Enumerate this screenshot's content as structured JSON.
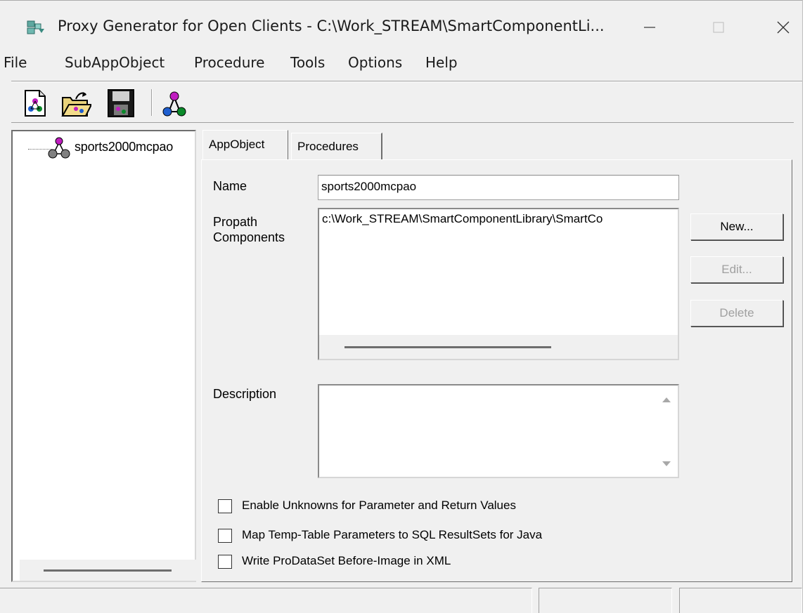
{
  "window": {
    "title": "Proxy Generator for Open Clients - C:\\Work_STREAM\\SmartComponentLi...",
    "icon": "proxy-generator-app-icon"
  },
  "menu": {
    "items": [
      "File",
      "SubAppObject",
      "Procedure",
      "Tools",
      "Options",
      "Help"
    ]
  },
  "toolbar": {
    "buttons": [
      {
        "name": "new-project",
        "icon": "new-document-icon"
      },
      {
        "name": "open-project",
        "icon": "open-folder-icon"
      },
      {
        "name": "save-project",
        "icon": "save-disk-icon"
      },
      {
        "name": "generate",
        "icon": "molecule-generate-icon"
      }
    ]
  },
  "tree": {
    "root_label": "sports2000mcpao",
    "root_icon": "appobject-icon"
  },
  "tabs": [
    {
      "label": "AppObject",
      "active": true
    },
    {
      "label": "Procedures",
      "active": false
    }
  ],
  "form": {
    "name_label": "Name",
    "name_value": "sports2000mcpao",
    "propath_label_line1": "Propath",
    "propath_label_line2": "Components",
    "propath_items": [
      "c:\\Work_STREAM\\SmartComponentLibrary\\SmartCo"
    ],
    "description_label": "Description",
    "description_value": "",
    "buttons": {
      "new": "New...",
      "edit": "Edit...",
      "delete": "Delete"
    },
    "checkboxes": [
      {
        "label": "Enable Unknowns for Parameter and Return Values",
        "checked": false
      },
      {
        "label": "Map Temp-Table Parameters to SQL ResultSets for Java",
        "checked": false
      },
      {
        "label": "Write ProDataSet Before-Image in XML",
        "checked": false
      }
    ]
  },
  "colors": {
    "window_bg": "#f0f0f0",
    "field_bg": "#ffffff",
    "disabled_text": "#a0a0a0"
  }
}
